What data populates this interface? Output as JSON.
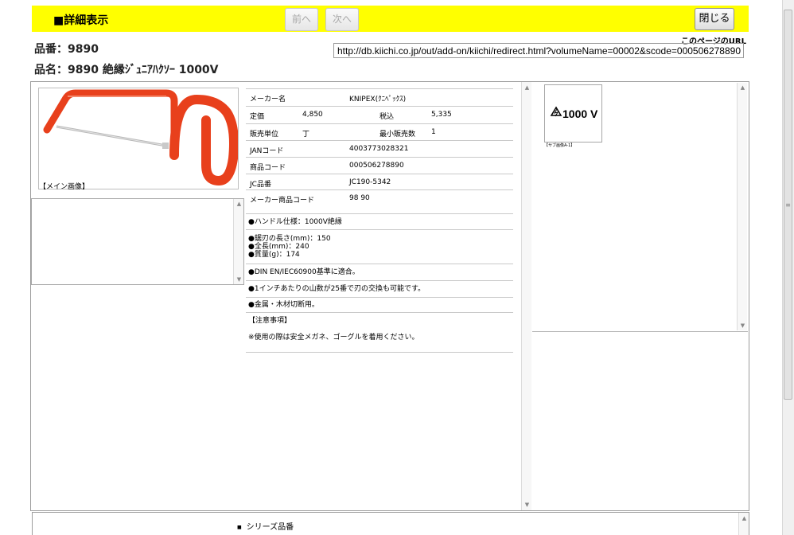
{
  "header": {
    "title": "■詳細表示",
    "prev_label": "前へ",
    "next_label": "次へ",
    "close_label": "閉じる",
    "background": "#ffff00"
  },
  "page_url": {
    "label": "このページのURL",
    "value": "http://db.kiichi.co.jp/out/add-on/kiichi/redirect.html?volumeName=00002&scode=000506278890"
  },
  "product": {
    "number_line": "品番：9890",
    "name_line": "品名：9890 絶縁ｼﾞｭﾆｱﾊｸｿｰ 1000V"
  },
  "main_image": {
    "caption": "【メイン画像】",
    "color": "#e8401c"
  },
  "specs": {
    "maker_label": "メーカー名",
    "maker_value": "KNIPEX(ｸﾆﾍﾟｯｸｽ)",
    "price_label": "定価",
    "price_value": "4,850",
    "tax_label": "税込",
    "tax_value": "5,335",
    "unit_label": "販売単位",
    "unit_value": "丁",
    "min_label": "最小販売数",
    "min_value": "1",
    "jan_label": "JANコード",
    "jan_value": "4003773028321",
    "code_label": "商品コード",
    "code_value": "000506278890",
    "jc_label": "JC品番",
    "jc_value": "JC190-5342",
    "maker_code_label": "メーカー商品コード",
    "maker_code_value": "98 90"
  },
  "notes": {
    "handle": "●ハンドル仕様：1000V絶縁",
    "dim1": "●鋸刃の長さ(mm)：150",
    "dim2": "●全長(mm)：240",
    "dim3": "●質量(g)：174",
    "standard": "●DIN EN/IEC60900基準に適合。",
    "teeth": "●1インチあたりの山数が25番で刃の交換も可能です。",
    "material": "●金属・木材切断用。",
    "caution_title": "【注意事項】",
    "caution_text": "※使用の際は安全メガネ、ゴーグルを着用ください。"
  },
  "sub_image": {
    "mark_text": "1000 V",
    "caption": "【サブ画像A-1】"
  },
  "bottom": {
    "series_label": "シリーズ品番"
  },
  "icons": {
    "scroll_up": "▲",
    "scroll_down": "▼",
    "bullet": "■"
  }
}
